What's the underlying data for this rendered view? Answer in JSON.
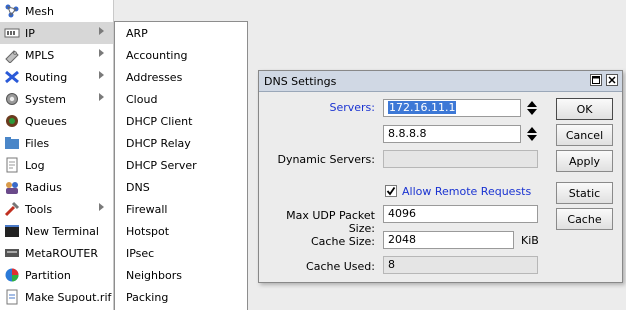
{
  "main_menu": {
    "items": [
      {
        "label": "Mesh",
        "icon": "mesh-icon"
      },
      {
        "label": "IP",
        "icon": "ip-icon",
        "submenu": true
      },
      {
        "label": "MPLS",
        "icon": "mpls-icon",
        "submenu": true
      },
      {
        "label": "Routing",
        "icon": "routing-icon",
        "submenu": true
      },
      {
        "label": "System",
        "icon": "gear-icon",
        "submenu": true
      },
      {
        "label": "Queues",
        "icon": "queues-icon"
      },
      {
        "label": "Files",
        "icon": "folder-icon"
      },
      {
        "label": "Log",
        "icon": "log-icon"
      },
      {
        "label": "Radius",
        "icon": "radius-icon"
      },
      {
        "label": "Tools",
        "icon": "tools-icon",
        "submenu": true
      },
      {
        "label": "New Terminal",
        "icon": "terminal-icon"
      },
      {
        "label": "MetaROUTER",
        "icon": "metarouter-icon"
      },
      {
        "label": "Partition",
        "icon": "partition-icon"
      },
      {
        "label": "Make Supout.rif",
        "icon": "supout-icon"
      }
    ]
  },
  "ip_submenu": {
    "items": [
      "ARP",
      "Accounting",
      "Addresses",
      "Cloud",
      "DHCP Client",
      "DHCP Relay",
      "DHCP Server",
      "DNS",
      "Firewall",
      "Hotspot",
      "IPsec",
      "Neighbors",
      "Packing"
    ]
  },
  "dialog": {
    "title": "DNS Settings",
    "servers_label": "Servers:",
    "server1": "172.16.11.1",
    "server2": "8.8.8.8",
    "dynamic_servers_label": "Dynamic Servers:",
    "dynamic_servers_value": "",
    "allow_remote_label": "Allow Remote Requests",
    "allow_remote_checked": true,
    "max_udp_label": "Max UDP Packet Size:",
    "max_udp_value": "4096",
    "cache_size_label": "Cache Size:",
    "cache_size_value": "2048",
    "cache_size_unit": "KiB",
    "cache_used_label": "Cache Used:",
    "cache_used_value": "8",
    "buttons": {
      "ok": "OK",
      "cancel": "Cancel",
      "apply": "Apply",
      "static": "Static",
      "cache": "Cache"
    }
  },
  "colors": {
    "accent_blue": "#1a33d1",
    "selection": "#3d78d6",
    "titlebar": "#d0d8e4"
  }
}
